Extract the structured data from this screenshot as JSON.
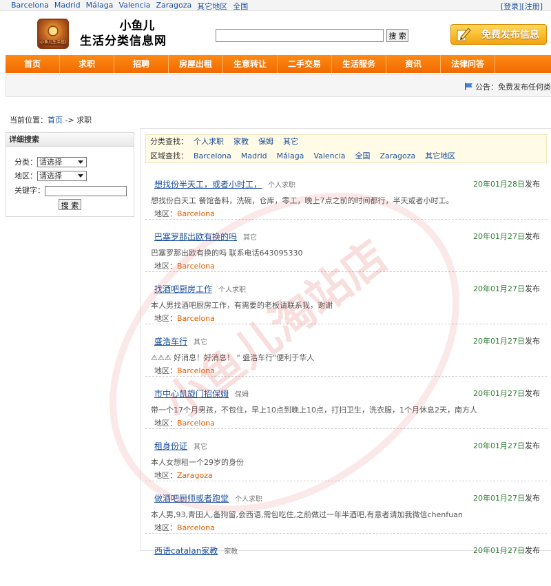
{
  "topbar": {
    "cities": [
      "Barcelona",
      "Madrid",
      "Málaga",
      "Valencia",
      "Zaragoza",
      "其它地区",
      "全国"
    ],
    "login": "[登录]",
    "register": "[注册]"
  },
  "header": {
    "site_name_line1": "小鱼儿",
    "site_name_line2": "生活分类信息网",
    "logo_text": "小鱼儿生活信息网",
    "search_button": "搜 索",
    "post_free": "免费发布信息"
  },
  "nav": [
    "首页",
    "求职",
    "招聘",
    "房屋出租",
    "生意转让",
    "二手交易",
    "生活服务",
    "资讯",
    "法律问答"
  ],
  "notice": "公告：免费发布任何类",
  "breadcrumb": {
    "prefix": "当前位置：",
    "home": "首页",
    "sep": " -> ",
    "current": "求职"
  },
  "side": {
    "title": "详细搜索",
    "category_label": "分类：",
    "category_value": "请选择",
    "region_label": "地区：",
    "region_value": "请选择",
    "keyword_label": "关键字：",
    "search_button": "搜 索"
  },
  "filters": {
    "category_label": "分类查找：",
    "categories": [
      "个人求职",
      "家教",
      "保姆",
      "其它"
    ],
    "region_label": "区域查找：",
    "regions": [
      "Barcelona",
      "Madrid",
      "Málaga",
      "Valencia",
      "全国",
      "Zaragoza",
      "其它地区"
    ]
  },
  "listings": [
    {
      "title": "想找份半天工，或者小时工，",
      "cat": "个人求职",
      "date": "20年01月28日",
      "suffix": "发布",
      "desc": "想找份白天工 餐馆备料，洗碗，仓库，零工，晚上7点之前的时间都行，半天或者小时工。",
      "region_label": "地区：",
      "region": "Barcelona"
    },
    {
      "title": "巴塞罗那出欧有换的吗",
      "cat": "其它",
      "date": "20年01月27日",
      "suffix": "发布",
      "desc": "巴塞罗那出欧有换的吗 联系电话643095330",
      "region_label": "地区：",
      "region": "Barcelona"
    },
    {
      "title": "找酒吧厨房工作",
      "cat": "个人求职",
      "date": "20年01月27日",
      "suffix": "发布",
      "desc": "本人男找酒吧厨房工作，有需要的老板请联系我，谢谢",
      "region_label": "地区：",
      "region": "Barcelona"
    },
    {
      "title": "盛浩车行",
      "cat": "其它",
      "date": "20年01月27日",
      "suffix": "发布",
      "desc": "⚠⚠⚠ 好消息！好消息！ \" 盛浩车行\"便利于华人",
      "region_label": "地区：",
      "region": "Barcelona"
    },
    {
      "title": "市中心凯旋门招保姆",
      "cat": "保姆",
      "date": "20年01月27日",
      "suffix": "发布",
      "desc": "带一个17个月男孩，不包住，早上10点到晚上10点，打扫卫生，洗衣服，1个月休息2天，南方人",
      "region_label": "地区：",
      "region": "Barcelona"
    },
    {
      "title": "租身份证",
      "cat": "其它",
      "date": "20年01月27日",
      "suffix": "发布",
      "desc": "本人女想租一个29岁的身份",
      "region_label": "地区：",
      "region": "Zaragoza"
    },
    {
      "title": "做酒吧厨师或者跑堂",
      "cat": "个人求职",
      "date": "20年01月27日",
      "suffix": "发布",
      "desc": "本人男,93,青田人,备狗留,会西语,需包吃住,之前做过一年半酒吧,有意者请加我微信chenfuan",
      "region_label": "地区：",
      "region": "Barcelona"
    },
    {
      "title": "西语catalan家教",
      "cat": "家教",
      "date": "20年01月27日",
      "suffix": "发布",
      "desc": "",
      "region_label": "",
      "region": ""
    }
  ],
  "watermark": "小鱼儿淘站店"
}
